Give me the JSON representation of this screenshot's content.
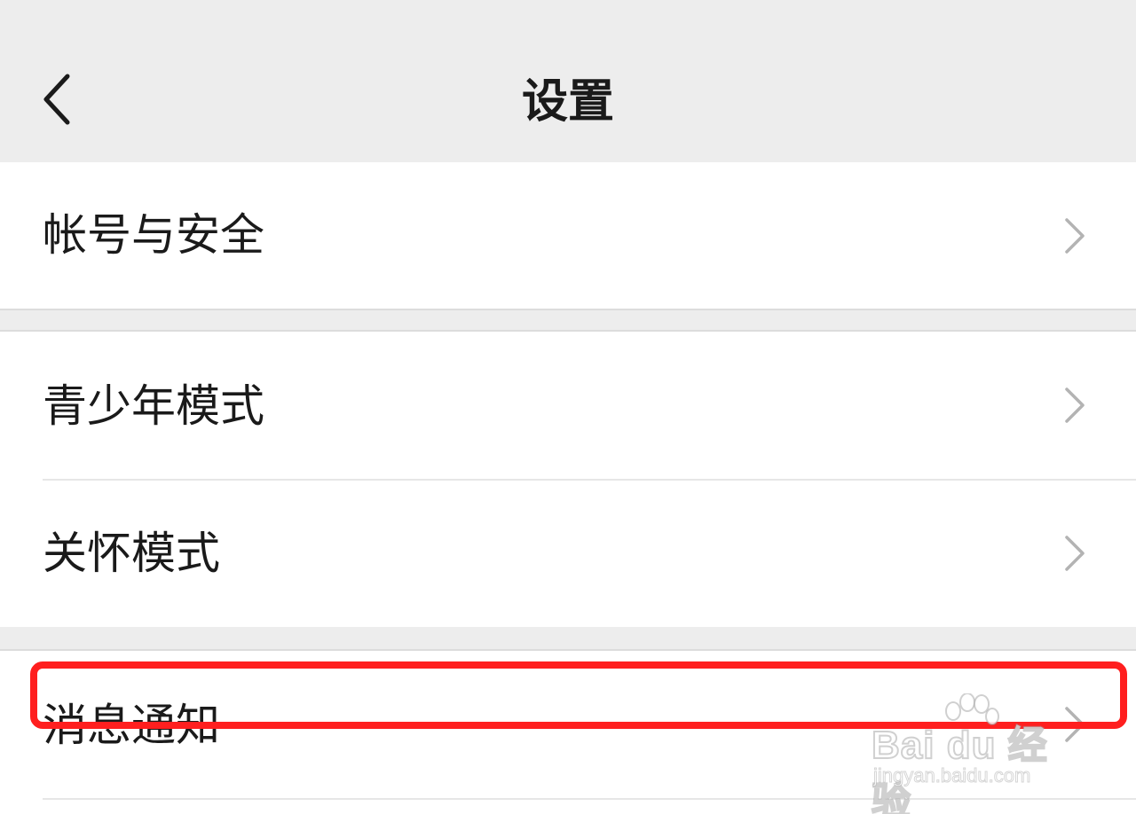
{
  "navbar": {
    "title": "设置",
    "back_icon": "chevron-left-icon"
  },
  "settings": {
    "items": [
      {
        "label": "帐号与安全",
        "icon": "chevron-right-icon"
      },
      {
        "label": "青少年模式",
        "icon": "chevron-right-icon"
      },
      {
        "label": "关怀模式",
        "icon": "chevron-right-icon"
      },
      {
        "label": "消息通知",
        "icon": "chevron-right-icon"
      }
    ]
  },
  "highlight": {
    "color": "#ff1f1f",
    "target": "消息通知"
  },
  "watermark": {
    "brand": "Bai du 经验",
    "url": "jingyan.baidu.com"
  },
  "colors": {
    "background": "#ededed",
    "row_background": "#ffffff",
    "text": "#1a1a1a",
    "chevron": "#b3b3b3"
  }
}
